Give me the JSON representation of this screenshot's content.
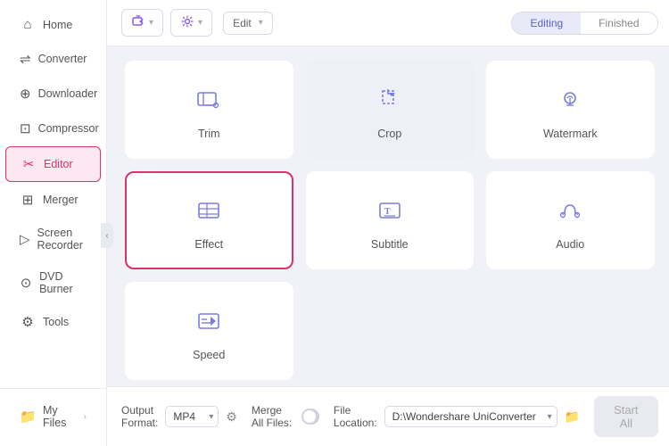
{
  "sidebar": {
    "items": [
      {
        "id": "home",
        "label": "Home",
        "icon": "🏠"
      },
      {
        "id": "converter",
        "label": "Converter",
        "icon": "🔄"
      },
      {
        "id": "downloader",
        "label": "Downloader",
        "icon": "⬇️"
      },
      {
        "id": "compressor",
        "label": "Compressor",
        "icon": "🗜️"
      },
      {
        "id": "editor",
        "label": "Editor",
        "icon": "✂️",
        "active": true
      },
      {
        "id": "merger",
        "label": "Merger",
        "icon": "⊞"
      },
      {
        "id": "screen-recorder",
        "label": "Screen Recorder",
        "icon": "🎥"
      },
      {
        "id": "dvd-burner",
        "label": "DVD Burner",
        "icon": "💿"
      },
      {
        "id": "tools",
        "label": "Tools",
        "icon": "🔧"
      }
    ],
    "bottom": {
      "label": "My Files",
      "icon": "📁"
    }
  },
  "toolbar": {
    "add_label": "",
    "settings_label": "",
    "edit_label": "Edit",
    "tabs": [
      {
        "id": "editing",
        "label": "Editing",
        "active": true
      },
      {
        "id": "finished",
        "label": "Finished",
        "active": false
      }
    ]
  },
  "grid": {
    "items": [
      {
        "id": "trim",
        "label": "Trim",
        "selected": false,
        "highlighted": false
      },
      {
        "id": "crop",
        "label": "Crop",
        "selected": false,
        "highlighted": true
      },
      {
        "id": "watermark",
        "label": "Watermark",
        "selected": false,
        "highlighted": false
      },
      {
        "id": "effect",
        "label": "Effect",
        "selected": true,
        "highlighted": false
      },
      {
        "id": "subtitle",
        "label": "Subtitle",
        "selected": false,
        "highlighted": false
      },
      {
        "id": "audio",
        "label": "Audio",
        "selected": false,
        "highlighted": false
      },
      {
        "id": "speed",
        "label": "Speed",
        "selected": false,
        "highlighted": false
      }
    ]
  },
  "footer": {
    "output_format_label": "Output Format:",
    "output_format_value": "MP4",
    "merge_label": "Merge All Files:",
    "file_location_label": "File Location:",
    "file_location_value": "D:\\Wondershare UniConverter",
    "start_label": "Start All"
  }
}
